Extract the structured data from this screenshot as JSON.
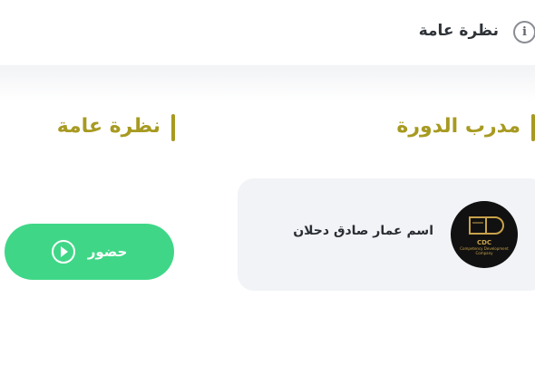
{
  "header": {
    "title": "نظرة عامة",
    "info_icon": "info-icon"
  },
  "sections": {
    "trainer_heading": "مدرب الدورة",
    "overview_heading": "نظرة عامة"
  },
  "trainer": {
    "name": "اسم عمار صادق دحلان",
    "logo_text": "CDC",
    "logo_subtext": "Competency Development Company"
  },
  "actions": {
    "attend_label": "حضور",
    "attend_icon": "play-circle-icon"
  },
  "colors": {
    "accent": "#a79a21",
    "attend_button": "#3fd787",
    "card_bg": "#f1f3f6",
    "title_text": "#2f3338"
  }
}
